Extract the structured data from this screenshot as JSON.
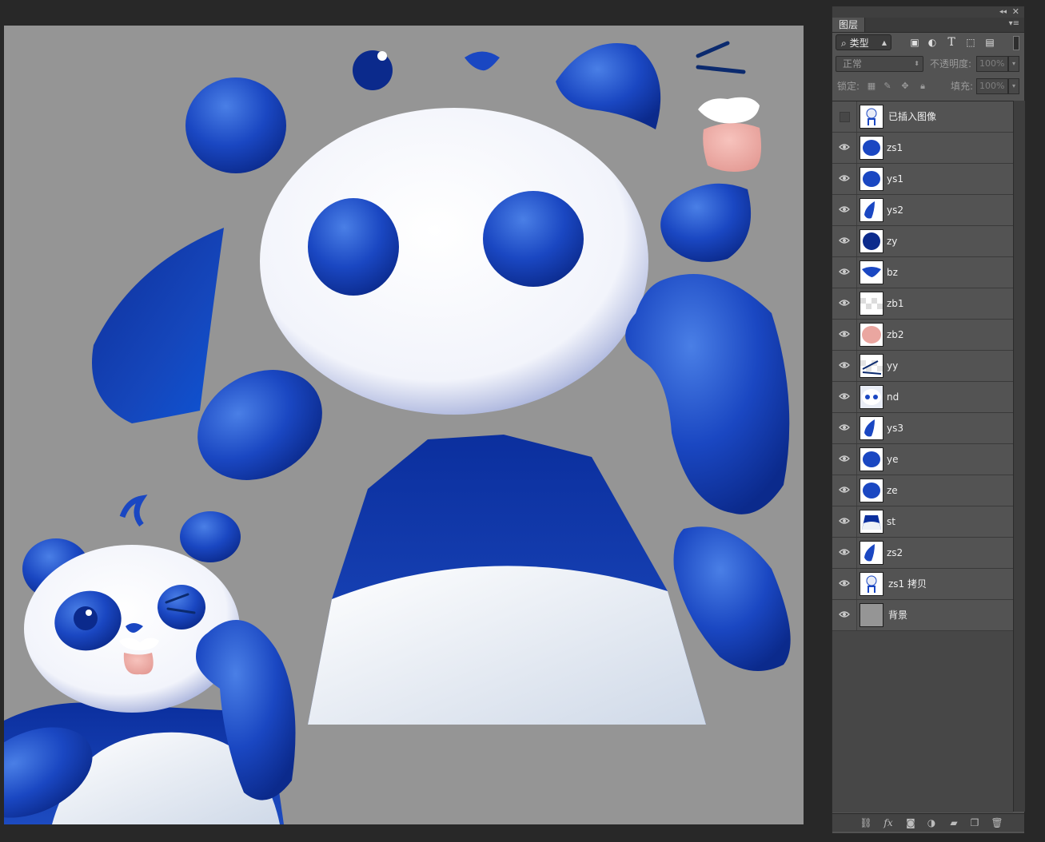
{
  "panel": {
    "tab_label": "图层",
    "icons": [
      "collapse-icon",
      "close-icon",
      "panel-menu-icon"
    ]
  },
  "filter": {
    "kind_label": "类型",
    "icons": [
      "image-filter-icon",
      "adjustment-filter-icon",
      "type-filter-icon",
      "shape-filter-icon",
      "smart-object-filter-icon"
    ]
  },
  "blend": {
    "mode": "正常",
    "opacity_label": "不透明度:",
    "opacity_value": "100%"
  },
  "lock": {
    "label": "锁定:",
    "icons": [
      "lock-transparent-icon",
      "lock-paint-icon",
      "lock-position-icon",
      "lock-all-icon"
    ],
    "fill_label": "填充:",
    "fill_value": "100%"
  },
  "layers": [
    {
      "name": "已插入图像",
      "visible": false,
      "thumb": "panda-sticker"
    },
    {
      "name": "zs1",
      "visible": true,
      "thumb": "blue-blob"
    },
    {
      "name": "ys1",
      "visible": true,
      "thumb": "blue-blob"
    },
    {
      "name": "ys2",
      "visible": true,
      "thumb": "blue-leaf"
    },
    {
      "name": "zy",
      "visible": true,
      "thumb": "blue-circle"
    },
    {
      "name": "bz",
      "visible": true,
      "thumb": "blue-nose"
    },
    {
      "name": "zb1",
      "visible": true,
      "thumb": "transparent"
    },
    {
      "name": "zb2",
      "visible": true,
      "thumb": "pink-blob"
    },
    {
      "name": "yy",
      "visible": true,
      "thumb": "eye-line"
    },
    {
      "name": "nd",
      "visible": true,
      "thumb": "white-face"
    },
    {
      "name": "ys3",
      "visible": true,
      "thumb": "blue-leaf"
    },
    {
      "name": "ye",
      "visible": true,
      "thumb": "blue-blob"
    },
    {
      "name": "ze",
      "visible": true,
      "thumb": "blue-blob"
    },
    {
      "name": "st",
      "visible": true,
      "thumb": "body"
    },
    {
      "name": "zs2",
      "visible": true,
      "thumb": "blue-leaf"
    },
    {
      "name": "zs1 拷贝",
      "visible": true,
      "thumb": "panda-sticker"
    },
    {
      "name": "背景",
      "visible": true,
      "thumb": "gray"
    }
  ],
  "bottom_icons": [
    "link-layers-icon",
    "fx-icon",
    "mask-icon",
    "adjustment-layer-icon",
    "group-folder-icon",
    "new-layer-icon",
    "trash-icon"
  ],
  "colors": {
    "canvas_bg": "#959595",
    "panda_blue": "#1a3fb6",
    "panda_dark_blue": "#0b2a8c",
    "tongue_pink": "#eaa6a0",
    "panel_bg": "#535353"
  }
}
